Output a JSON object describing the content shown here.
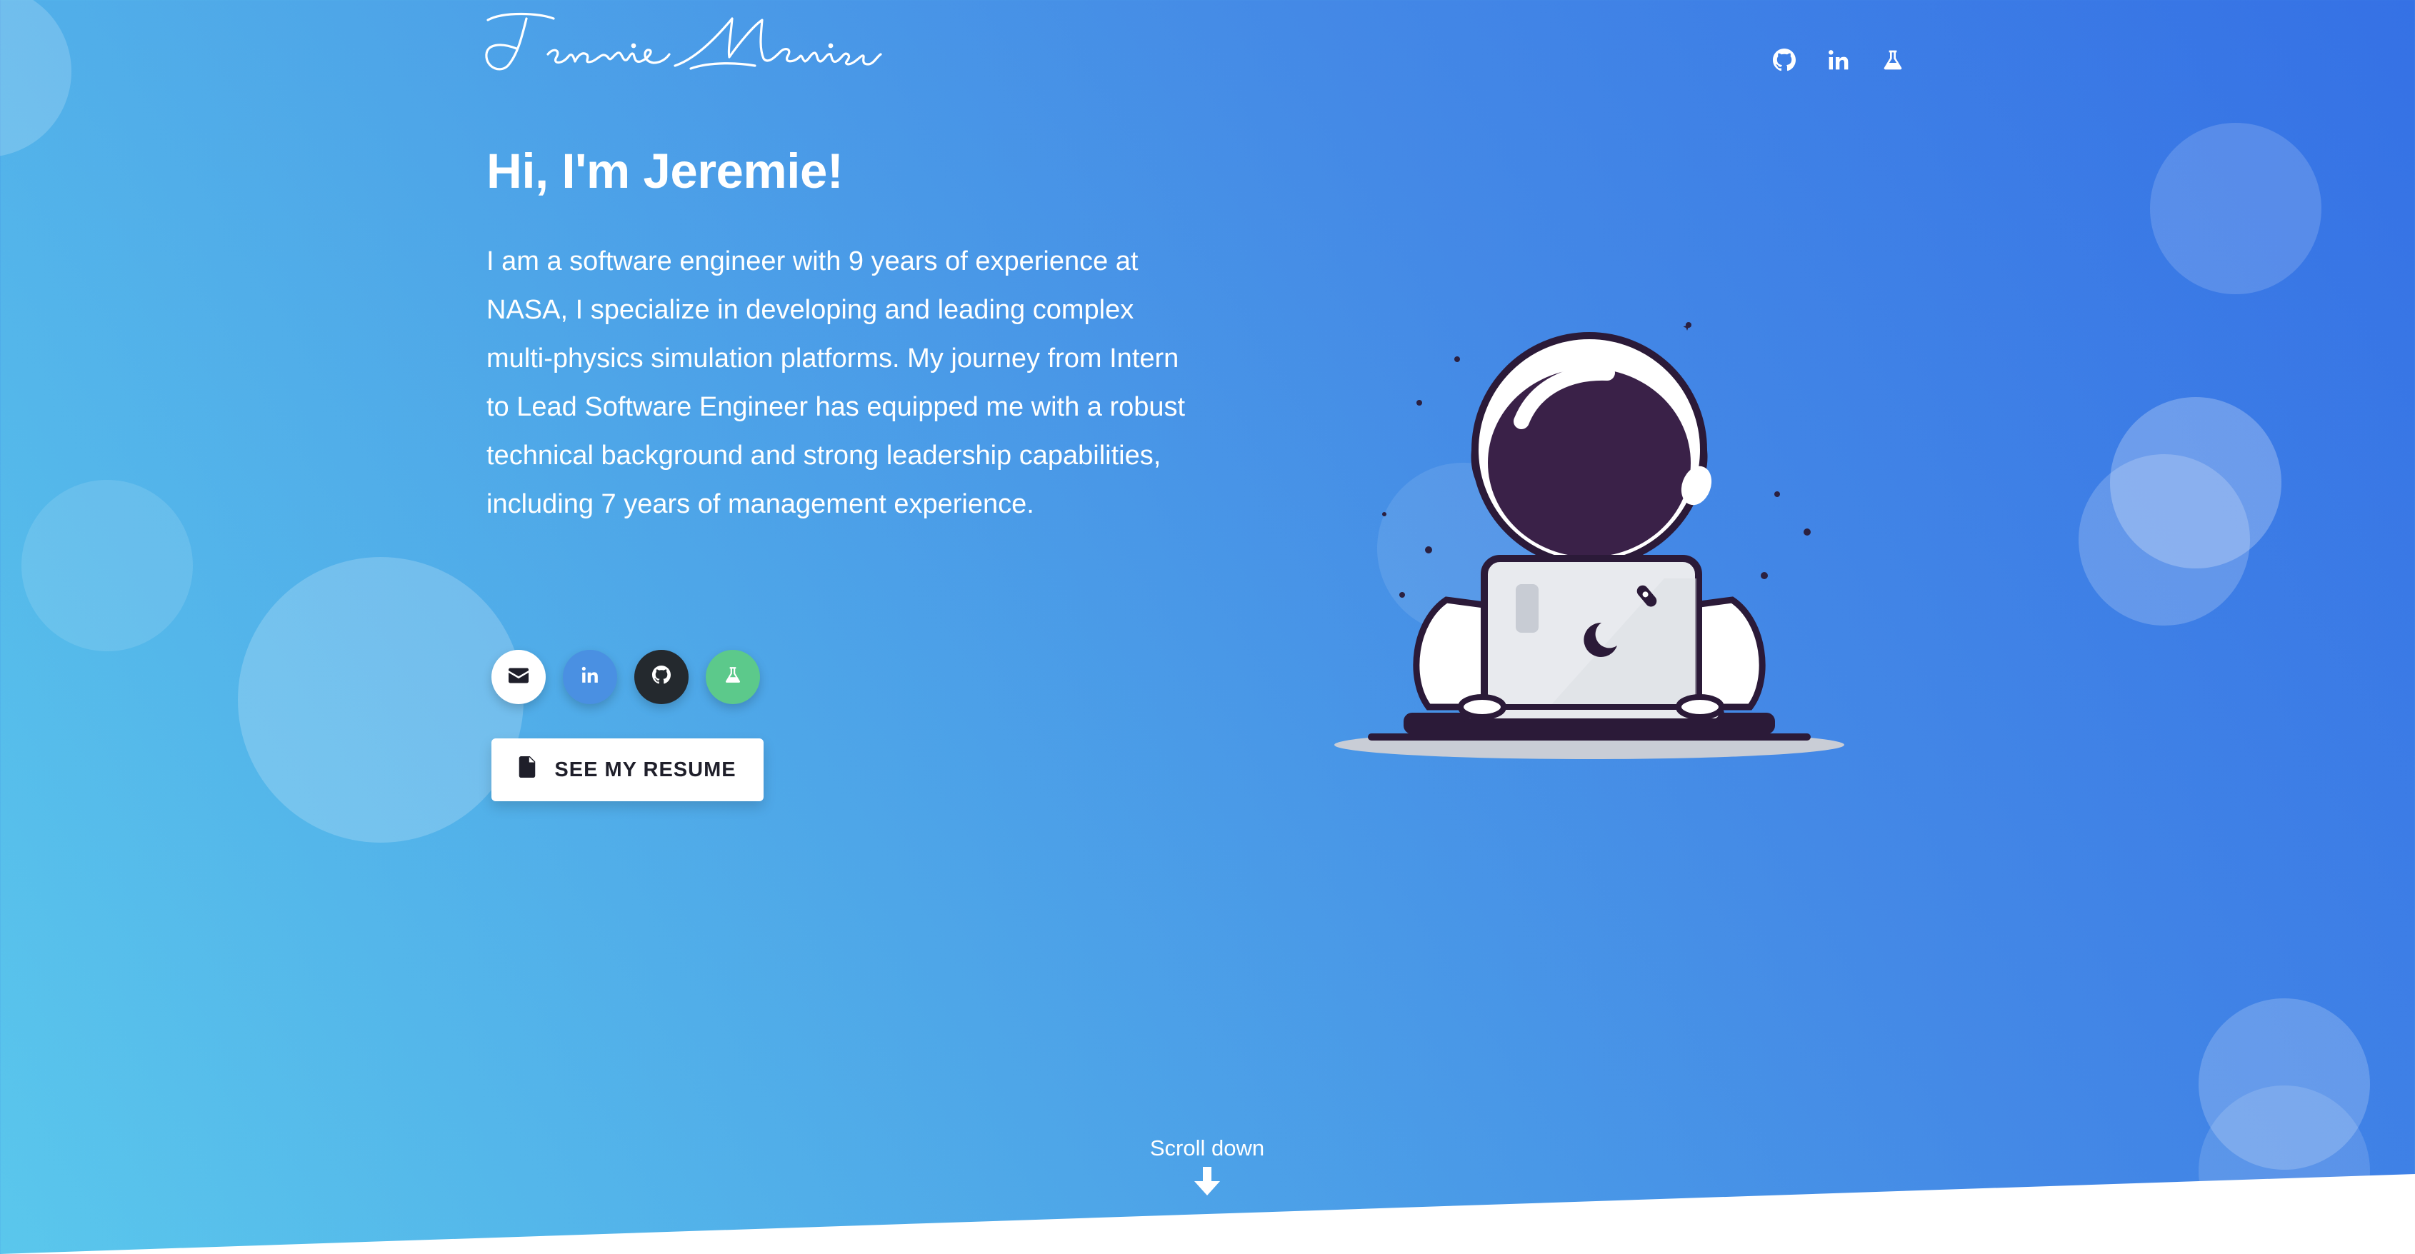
{
  "header": {
    "logo_text": "Jeremie Meurisse",
    "nav_icons": [
      "github-icon",
      "linkedin-icon",
      "flask-icon"
    ]
  },
  "hero": {
    "title": "Hi, I'm Jeremie!",
    "description": "I am a software engineer with 9 years of experience at NASA, I specialize in developing and leading complex multi-physics simulation platforms. My journey from Intern to Lead Software Engineer has equipped me with a robust technical background and strong leadership capabilities, including 7 years of management experience."
  },
  "social_buttons": [
    {
      "icon": "envelope-icon",
      "color": "#ffffff"
    },
    {
      "icon": "linkedin-icon",
      "color": "#4a90e2"
    },
    {
      "icon": "github-icon",
      "color": "#24292e"
    },
    {
      "icon": "flask-icon",
      "color": "#5cc98b"
    }
  ],
  "resume_button": {
    "label": "SEE MY RESUME",
    "icon": "file-icon"
  },
  "scroll": {
    "label": "Scroll down",
    "icon": "arrow-down-icon"
  },
  "colors": {
    "gradient_start": "#5ac7ec",
    "gradient_end": "#3571e5",
    "astronaut_helmet": "#3a2148"
  }
}
